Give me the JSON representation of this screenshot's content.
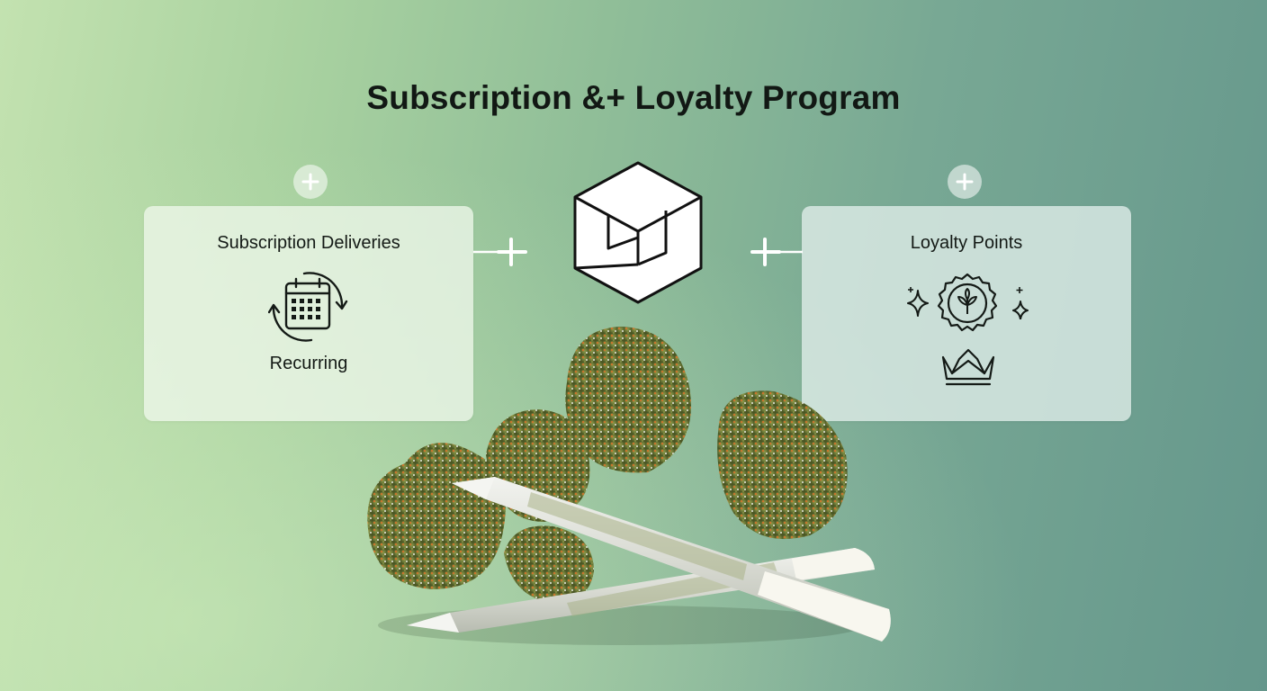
{
  "title": "Subscription &+ Loyalty Program",
  "cards": {
    "left": {
      "title": "Subscription Deliveries",
      "caption": "Recurring",
      "icon": "calendar-recurring-icon"
    },
    "right": {
      "title": "Loyalty Points",
      "icons": [
        "sparkle-icon",
        "leaf-badge-icon",
        "crown-icon"
      ]
    }
  },
  "center_icon": "cube-icon",
  "illustration": "cannabis-buds-and-pre-rolls",
  "colors": {
    "background_start": "#c3e2b0",
    "background_end": "#65978c",
    "text": "#121814"
  }
}
